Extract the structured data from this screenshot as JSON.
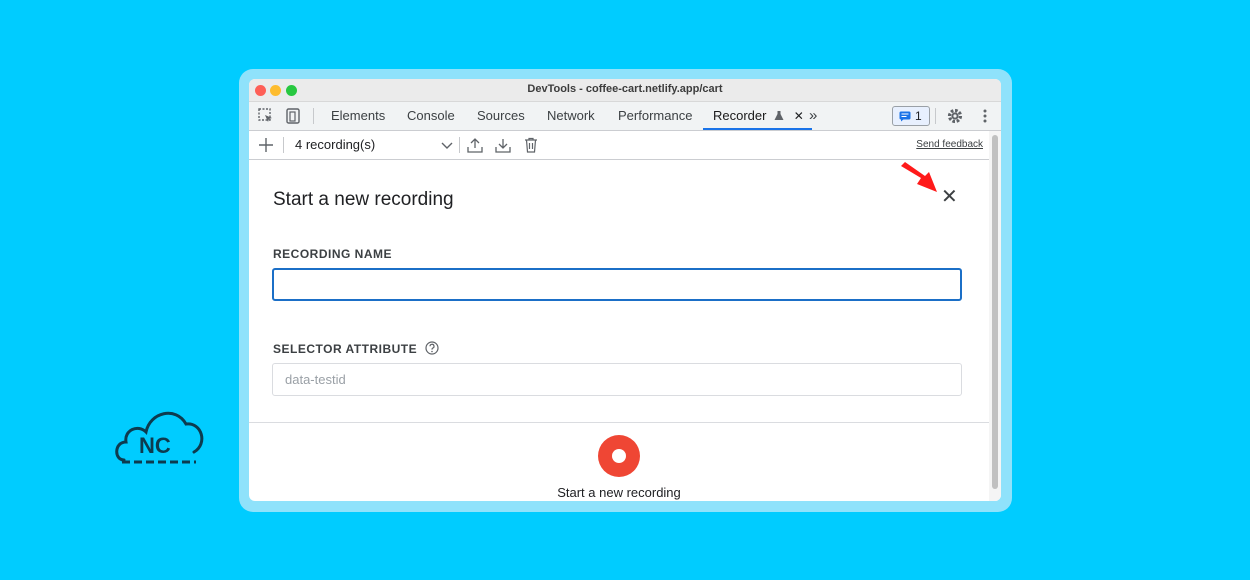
{
  "window": {
    "title": "DevTools - coffee-cart.netlify.app/cart"
  },
  "tabs": [
    {
      "label": "Elements"
    },
    {
      "label": "Console"
    },
    {
      "label": "Sources"
    },
    {
      "label": "Network"
    },
    {
      "label": "Performance"
    },
    {
      "label": "Recorder",
      "active": true
    }
  ],
  "tab_close_glyph": "✕",
  "more_tabs_glyph": "»",
  "issues_badge": {
    "count": "1"
  },
  "recorder_toolbar": {
    "recordings_select": "4 recording(s)",
    "send_feedback": "Send feedback"
  },
  "panel": {
    "title": "Start a new recording",
    "close_glyph": "✕",
    "recording_name_label": "RECORDING NAME",
    "recording_name_value": "",
    "selector_attribute_label": "SELECTOR ATTRIBUTE",
    "selector_attribute_placeholder": "data-testid",
    "start_button_caption": "Start a new recording"
  },
  "logo": {
    "text": "NC"
  },
  "colors": {
    "background": "#00ccff",
    "accent": "#1a73e8",
    "record": "#ef4634",
    "arrow": "#ff1a1a"
  }
}
